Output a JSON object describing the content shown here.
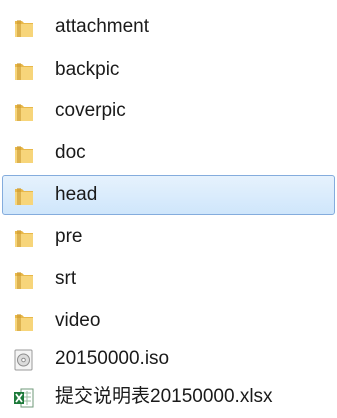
{
  "files": [
    {
      "name": "attachment",
      "icon": "folder-icon",
      "selected": false
    },
    {
      "name": "backpic",
      "icon": "folder-icon",
      "selected": false
    },
    {
      "name": "coverpic",
      "icon": "folder-icon",
      "selected": false
    },
    {
      "name": "doc",
      "icon": "folder-icon",
      "selected": false
    },
    {
      "name": "head",
      "icon": "folder-icon",
      "selected": true
    },
    {
      "name": "pre",
      "icon": "folder-icon",
      "selected": false
    },
    {
      "name": "srt",
      "icon": "folder-icon",
      "selected": false
    },
    {
      "name": "video",
      "icon": "folder-icon",
      "selected": false
    },
    {
      "name": "20150000.iso",
      "icon": "disc-image-icon",
      "selected": false
    },
    {
      "name": "提交说明表20150000.xlsx",
      "icon": "excel-file-icon",
      "selected": false
    }
  ],
  "colors": {
    "selection_bg": "#cfe6fb",
    "selection_border": "#84acdd",
    "folder": "#e8b84a",
    "excel": "#1d7a3a"
  }
}
